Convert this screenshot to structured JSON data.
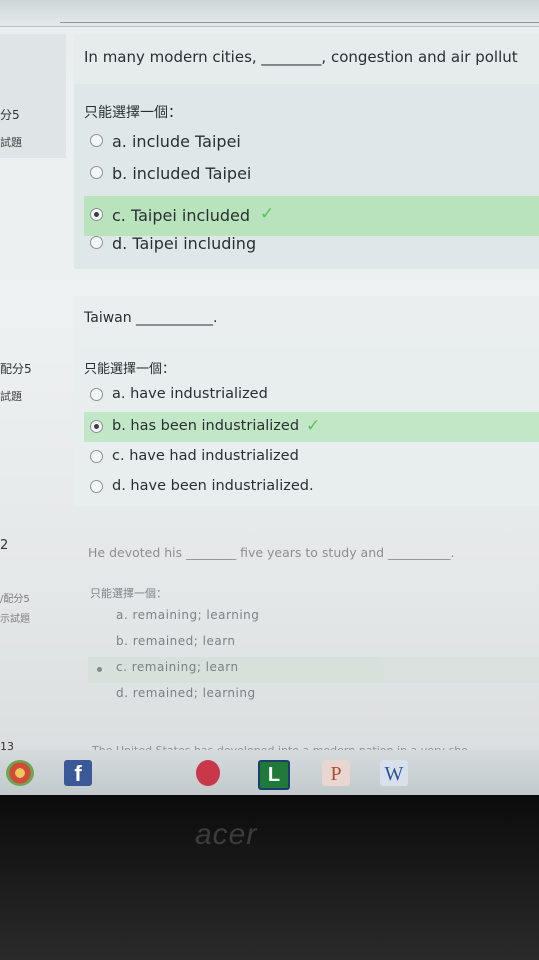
{
  "question1": {
    "text": "In many modern cities, ________, congestion and air pollut",
    "side_points": "分5",
    "side_label": "試題",
    "prompt": "只能選擇一個：",
    "options": [
      {
        "label": "a. include Taipei",
        "selected": false
      },
      {
        "label": "b. included Taipei",
        "selected": false
      },
      {
        "label": "c. Taipei included",
        "selected": true
      },
      {
        "label": "d. Taipei including",
        "selected": false
      }
    ],
    "check": "✓"
  },
  "question2": {
    "text": "Taiwan ___________.",
    "side_points": "配分5",
    "side_label": "試題",
    "prompt": "只能選擇一個：",
    "options": [
      {
        "label": "a. have industrialized",
        "selected": false
      },
      {
        "label": "b. has been industrialized",
        "selected": true
      },
      {
        "label": "c. have had industrialized",
        "selected": false
      },
      {
        "label": "d. have been industrialized.",
        "selected": false
      }
    ],
    "check": "✓"
  },
  "question3": {
    "number": "2",
    "text": "He devoted his ________ five years to study and __________.",
    "side_points": "/配分5",
    "side_label": "示試題",
    "prompt": "只能選擇一個：",
    "options": [
      {
        "label": "a. remaining; learning",
        "selected": false
      },
      {
        "label": "b. remained; learn",
        "selected": false
      },
      {
        "label": "c. remaining; learn",
        "selected": true
      },
      {
        "label": "d. remained; learning",
        "selected": false
      }
    ]
  },
  "question4": {
    "number": "13",
    "text": "The United States has developed into a modern nation in a very sho"
  },
  "taskbar": {
    "icons": [
      "chrome-icon",
      "facebook-icon",
      "app-icon",
      "l-app-icon",
      "powerpoint-icon",
      "word-icon"
    ],
    "facebook_glyph": "f",
    "l_glyph": "L",
    "p_glyph": "P",
    "w_glyph": "W"
  },
  "brand": "acer"
}
